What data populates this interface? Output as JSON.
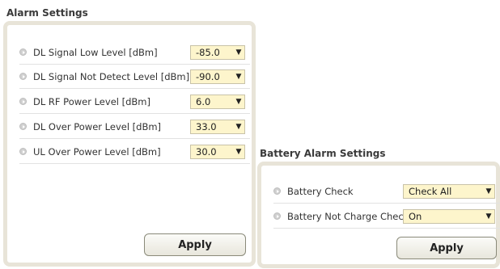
{
  "alarm_settings": {
    "title": "Alarm Settings",
    "rows": [
      {
        "label": "DL Signal Low Level [dBm]",
        "value": "-85.0"
      },
      {
        "label": "DL Signal Not Detect Level [dBm]",
        "value": "-90.0"
      },
      {
        "label": "DL RF Power Level [dBm]",
        "value": "6.0"
      },
      {
        "label": "DL Over Power Level [dBm]",
        "value": "33.0"
      },
      {
        "label": "UL Over Power Level [dBm]",
        "value": "30.0"
      }
    ],
    "apply_label": "Apply"
  },
  "battery_alarm_settings": {
    "title": "Battery Alarm Settings",
    "rows": [
      {
        "label": "Battery Check",
        "value": "Check All"
      },
      {
        "label": "Battery Not Charge Check",
        "value": "On"
      }
    ],
    "apply_label": "Apply"
  },
  "icons": {
    "bullet": "arrow-bullet-icon",
    "dropdown": "chevron-down-icon"
  },
  "colors": {
    "select_bg": "#fdf5cc",
    "panel_border": "#e8e4d8"
  }
}
